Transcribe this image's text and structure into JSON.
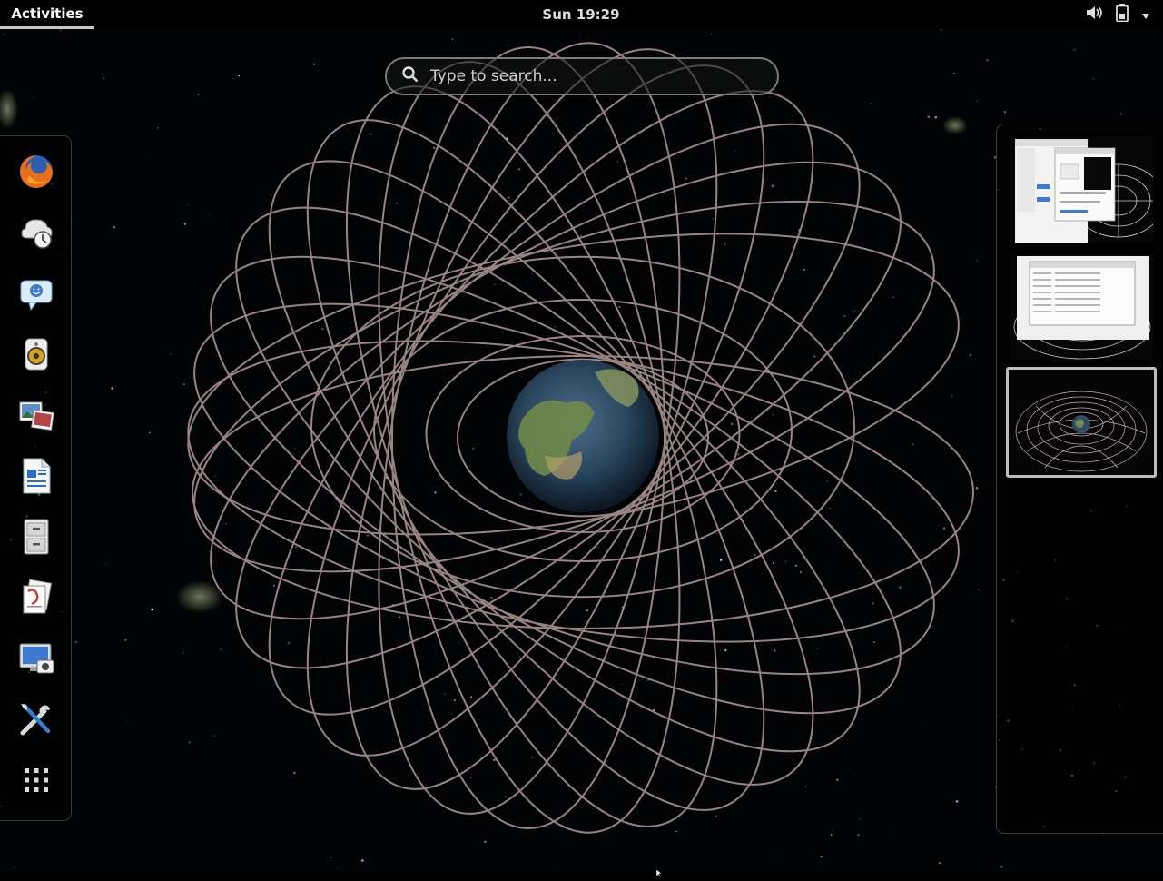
{
  "topbar": {
    "activities_label": "Activities",
    "clock": "Sun 19:29",
    "system_icons": [
      "volume-icon",
      "battery-icon",
      "system-menu-arrow-icon"
    ]
  },
  "search": {
    "placeholder": "Type to search..."
  },
  "dash": {
    "items": [
      {
        "name": "firefox",
        "icon": "firefox-icon"
      },
      {
        "name": "backup",
        "icon": "backup-clock-icon"
      },
      {
        "name": "empathy-chat",
        "icon": "chat-bubble-icon"
      },
      {
        "name": "rhythmbox",
        "icon": "speaker-icon"
      },
      {
        "name": "shotwell-photos",
        "icon": "photos-icon"
      },
      {
        "name": "libreoffice-writer",
        "icon": "document-writer-icon"
      },
      {
        "name": "file-manager",
        "icon": "file-cabinet-icon"
      },
      {
        "name": "document-viewer",
        "icon": "documents-icon"
      },
      {
        "name": "screenshot",
        "icon": "screenshot-icon"
      },
      {
        "name": "tweak-tool",
        "icon": "tools-icon"
      },
      {
        "name": "show-applications",
        "icon": "app-grid-icon"
      }
    ]
  },
  "workspaces": [
    {
      "name": "workspace-1",
      "active": false
    },
    {
      "name": "workspace-2",
      "active": false
    },
    {
      "name": "workspace-3",
      "active": true
    }
  ],
  "colors": {
    "panel_bg": "#000000",
    "net_lines": "#b39b98",
    "search_border": "#7c7c7c",
    "active_workspace_border": "#bdbdbd"
  }
}
